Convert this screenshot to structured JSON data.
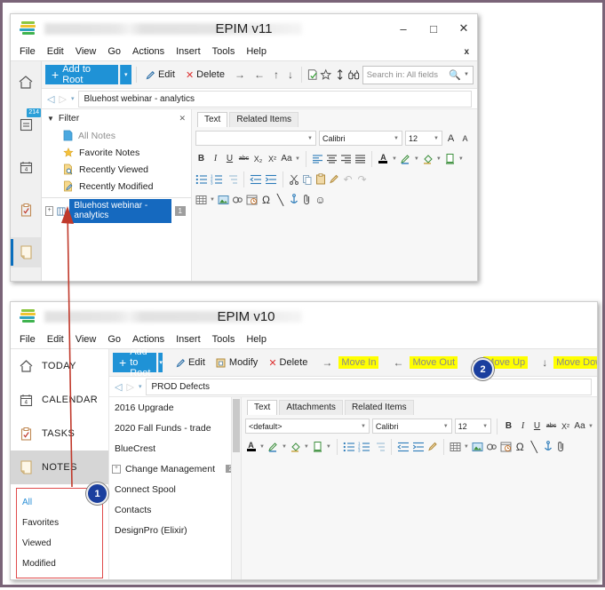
{
  "window_v11": {
    "title": "EPIM v11",
    "title_blurred": true,
    "controls": {
      "minimize": "–",
      "maximize": "□",
      "close": "✕"
    },
    "menu": [
      "File",
      "Edit",
      "View",
      "Go",
      "Actions",
      "Insert",
      "Tools",
      "Help"
    ],
    "menu_close": "x",
    "rail": [
      {
        "name": "home",
        "icon": "home-icon",
        "badge": ""
      },
      {
        "name": "notes-count",
        "icon": "document-icon",
        "badge": "214"
      },
      {
        "name": "calendar",
        "icon": "calendar-icon",
        "badge": "4"
      },
      {
        "name": "tasks",
        "icon": "clipboard-icon",
        "badge": ""
      },
      {
        "name": "notes",
        "icon": "note-icon",
        "badge": "",
        "selected": true
      }
    ],
    "toolbar": {
      "add_label": "Add to Root",
      "add_caret": "▾",
      "edit_label": "Edit",
      "delete_label": "Delete",
      "arrows": [
        "→",
        "←",
        "↑",
        "↓"
      ],
      "icons": [
        "note-check-icon",
        "star-icon",
        "updown-arrow-icon",
        "binoculars-icon"
      ],
      "search_placeholder": "Search in: All fields",
      "search_value": ""
    },
    "breadcrumb": {
      "back": "◁",
      "forward": "▷",
      "caret": "▾",
      "value": "Bluehost webinar - analytics"
    },
    "filter": {
      "header": "Filter",
      "close": "✕",
      "items": [
        {
          "label": "All Notes",
          "icon": "page-icon",
          "muted": true
        },
        {
          "label": "Favorite Notes",
          "icon": "star-icon",
          "muted": false
        },
        {
          "label": "Recently Viewed",
          "icon": "page-search-icon",
          "muted": false
        },
        {
          "label": "Recently Modified",
          "icon": "page-edit-icon",
          "muted": false
        }
      ]
    },
    "note_item": {
      "label": "Bluehost webinar - analytics",
      "count": "1",
      "expander": "+"
    },
    "editor": {
      "tabs": [
        "Text",
        "Related Items"
      ],
      "active_tab": "Text",
      "style_value": "",
      "font_value": "Calibri",
      "size_value": "12",
      "grow_label": "A",
      "shrink_label": "A",
      "row2": [
        "B",
        "I",
        "U",
        "abc",
        "X₂",
        "X²",
        "Aa"
      ],
      "align_icons": [
        "align-left-icon",
        "align-center-icon",
        "align-right-icon",
        "align-justify-icon"
      ],
      "color_icons": [
        "font-color-icon",
        "highlight-icon",
        "fill-color-icon",
        "page-color-icon"
      ],
      "row3_icons": [
        "bullet-list-icon",
        "numbered-list-icon",
        "multilevel-list-icon",
        "decrease-indent-icon",
        "increase-indent-icon",
        "cut-icon",
        "copy-icon",
        "paste-icon",
        "format-painter-icon",
        "undo-icon",
        "redo-icon"
      ],
      "row4_icons": [
        "table-icon",
        "image-icon",
        "link-icon",
        "datetime-icon",
        "symbol-icon",
        "line-icon",
        "anchor-icon",
        "attachment-icon",
        "emoticon-icon"
      ]
    }
  },
  "window_v10": {
    "title": "EPIM v10",
    "title_blurred": true,
    "menu": [
      "File",
      "Edit",
      "View",
      "Go",
      "Actions",
      "Insert",
      "Tools",
      "Help"
    ],
    "rail": [
      {
        "label": "TODAY",
        "icon": "home-icon",
        "selected": false
      },
      {
        "label": "CALENDAR",
        "icon": "calendar-icon",
        "selected": false
      },
      {
        "label": "TASKS",
        "icon": "clipboard-icon",
        "selected": false
      },
      {
        "label": "NOTES",
        "icon": "note-icon",
        "selected": true
      }
    ],
    "sub_filters": [
      {
        "label": "All",
        "active": true
      },
      {
        "label": "Favorites",
        "active": false
      },
      {
        "label": "Viewed",
        "active": false
      },
      {
        "label": "Modified",
        "active": false
      }
    ],
    "toolbar": {
      "add_label": "Add to Root",
      "add_caret": "▾",
      "edit_label": "Edit",
      "modify_label": "Modify",
      "delete_label": "Delete",
      "move_buttons": [
        {
          "arrow": "→",
          "label": "Move In",
          "highlighted": true
        },
        {
          "arrow": "←",
          "label": "Move Out",
          "highlighted": true
        },
        {
          "arrow": "↑",
          "label": "Move Up",
          "highlighted": true
        },
        {
          "arrow": "↓",
          "label": "Move Down",
          "highlighted": true
        }
      ],
      "icons": [
        "note-check-icon",
        "star-icon",
        "updown-arrow-icon",
        "binoculars-icon"
      ]
    },
    "breadcrumb": {
      "back": "◁",
      "forward": "▷",
      "caret": "▾",
      "value": "PROD Defects"
    },
    "notes_list": [
      {
        "label": "2016 Upgrade",
        "badge": "",
        "expander": false
      },
      {
        "label": "2020 Fall Funds - trade",
        "badge": "",
        "expander": false
      },
      {
        "label": "BlueCrest",
        "badge": "",
        "expander": false
      },
      {
        "label": "Change Management",
        "badge": "2",
        "expander": true
      },
      {
        "label": "Connect Spool",
        "badge": "",
        "expander": false
      },
      {
        "label": "Contacts",
        "badge": "",
        "expander": false
      },
      {
        "label": "DesignPro (Elixir)",
        "badge": "",
        "expander": false
      }
    ],
    "editor": {
      "tabs": [
        "Text",
        "Attachments",
        "Related Items"
      ],
      "active_tab": "Text",
      "style_value": "<default>",
      "font_value": "Calibri",
      "size_value": "12",
      "row1_icons": [
        "B",
        "I",
        "U",
        "abc",
        "X²",
        "Aa"
      ],
      "row2_icons": [
        "font-color-icon",
        "highlight-icon",
        "fill-color-icon",
        "page-color-icon",
        "bullet-list-icon",
        "numbered-list-icon",
        "multilevel-list-icon",
        "decrease-indent-icon",
        "increase-indent-icon",
        "format-painter-icon",
        "table-icon",
        "image-icon",
        "link-icon",
        "datetime-icon",
        "symbol-icon",
        "line-icon",
        "anchor-icon",
        "attachment-icon"
      ]
    }
  },
  "annotations": {
    "callout_1": "1",
    "callout_2": "2",
    "arrow_color": "#c0392b"
  }
}
